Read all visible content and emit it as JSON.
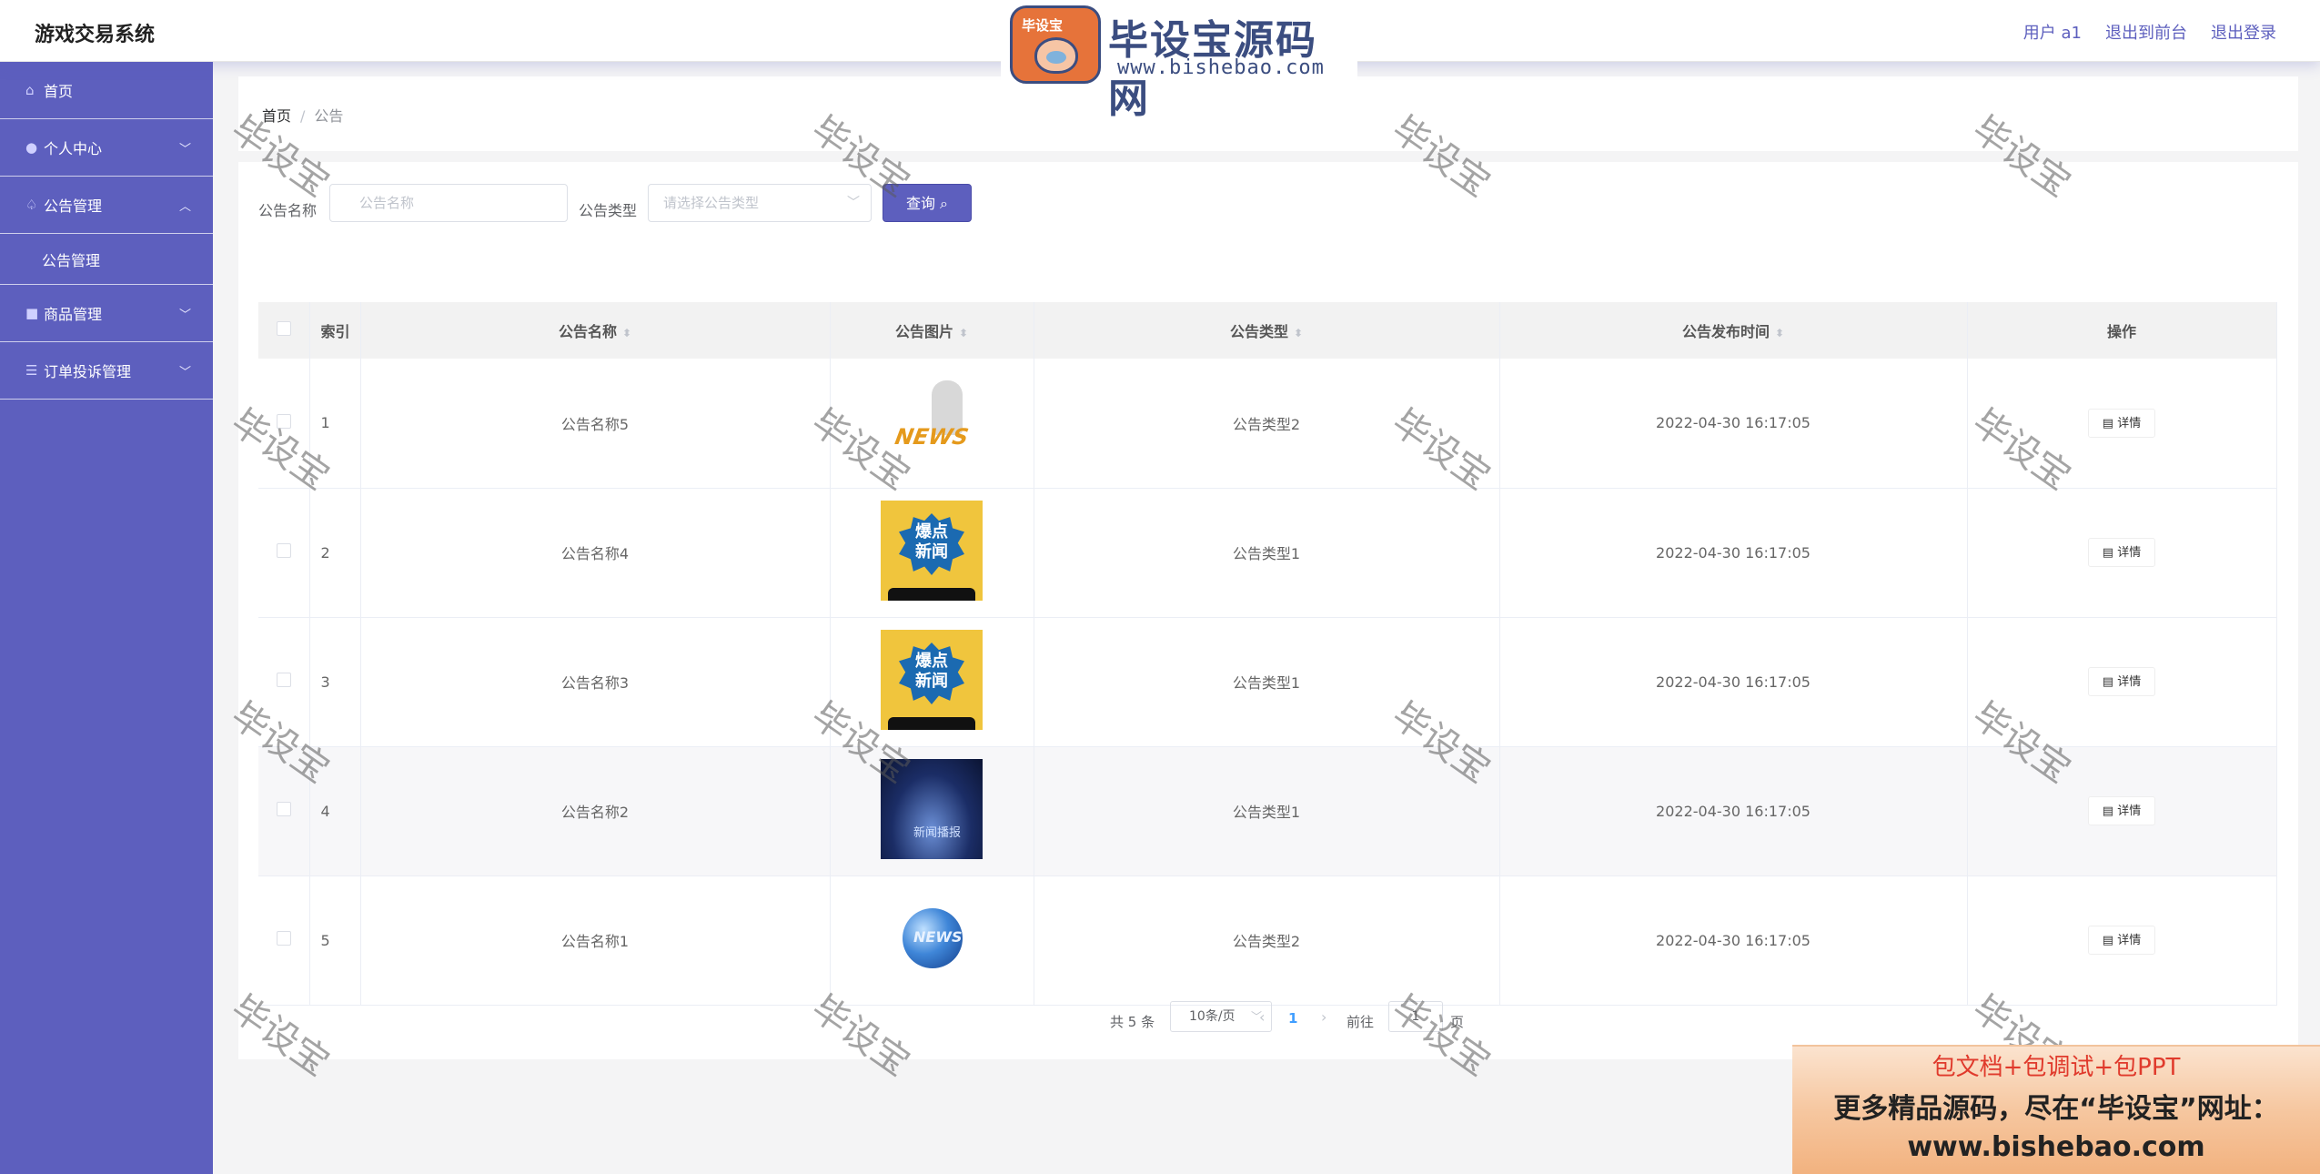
{
  "header": {
    "app_title": "游戏交易系统",
    "links": [
      "用户 a1",
      "退出到前台",
      "退出登录"
    ]
  },
  "logo": {
    "badge": "毕设宝",
    "name": "毕设宝源码网",
    "url": "www.bishebao.com"
  },
  "sidebar": {
    "items": [
      {
        "label": "首页",
        "icon": "home-icon"
      },
      {
        "label": "个人中心",
        "icon": "user-icon",
        "chevron": "down"
      },
      {
        "label": "公告管理",
        "icon": "bell-icon",
        "chevron": "up"
      },
      {
        "label": "公告管理",
        "sub": true
      },
      {
        "label": "商品管理",
        "icon": "bag-icon",
        "chevron": "down"
      },
      {
        "label": "订单投诉管理",
        "icon": "sliders-icon",
        "chevron": "down"
      }
    ]
  },
  "breadcrumb": {
    "home": "首页",
    "sep": "/",
    "current": "公告"
  },
  "search": {
    "name_label": "公告名称",
    "name_placeholder": "公告名称",
    "type_label": "公告类型",
    "type_placeholder": "请选择公告类型",
    "query_button": "查询 ⌕"
  },
  "table": {
    "headers": {
      "index": "索引",
      "name": "公告名称",
      "image": "公告图片",
      "type": "公告类型",
      "time": "公告发布时间",
      "actions": "操作"
    },
    "rows": [
      {
        "index": "1",
        "name": "公告名称5",
        "image": "news-figure-image",
        "type": "公告类型2",
        "time": "2022-04-30 16:17:05",
        "action": "详情",
        "img_text": "NEWS"
      },
      {
        "index": "2",
        "name": "公告名称4",
        "image": "breaking-news-image",
        "type": "公告类型1",
        "time": "2022-04-30 16:17:05",
        "action": "详情",
        "img_text": "爆点新闻"
      },
      {
        "index": "3",
        "name": "公告名称3",
        "image": "breaking-news-image",
        "type": "公告类型1",
        "time": "2022-04-30 16:17:05",
        "action": "详情",
        "img_text": "爆点新闻"
      },
      {
        "index": "4",
        "name": "公告名称2",
        "image": "stage-image",
        "type": "公告类型1",
        "time": "2022-04-30 16:17:05",
        "action": "详情",
        "img_text": "新闻播报"
      },
      {
        "index": "5",
        "name": "公告名称1",
        "image": "globe-image",
        "type": "公告类型2",
        "time": "2022-04-30 16:17:05",
        "action": "详情",
        "img_text": "NEWS"
      }
    ]
  },
  "pagination": {
    "total": "共 5 条",
    "page_size": "10条/页",
    "current": "1",
    "goto_label": "前往",
    "goto_value": "1",
    "goto_suffix": "页"
  },
  "watermark": "毕设宝",
  "promo": {
    "line1": "包文档+包调试+包PPT",
    "line2": "更多精品源码，尽在“毕设宝”网址：",
    "line3": "www.bishebao.com"
  },
  "colors": {
    "accent": "#5d5fbe",
    "page_link": "#409eff"
  }
}
